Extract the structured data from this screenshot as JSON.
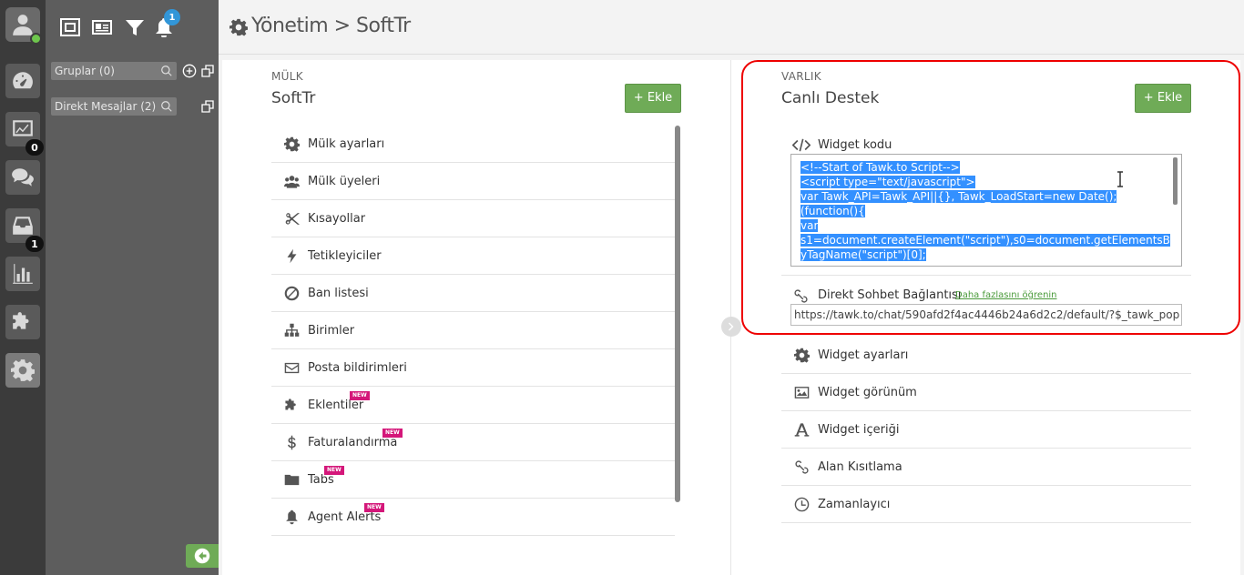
{
  "rail": {
    "badges": {
      "monitoring": "0",
      "inbox": "1"
    }
  },
  "panel2": {
    "notification_count": "1",
    "groups_search": "Gruplar (0)",
    "direct_messages_search": "Direkt Mesajlar (2)"
  },
  "header": {
    "title": "Yönetim > SoftTr"
  },
  "left": {
    "caption": "MÜLK",
    "title": "SoftTr",
    "add_label": "+ Ekle",
    "new_tag": "NEW",
    "items": [
      {
        "label": "Mülk ayarları",
        "icon": "gear-icon"
      },
      {
        "label": "Mülk üyeleri",
        "icon": "users-icon"
      },
      {
        "label": "Kısayollar",
        "icon": "scissors-icon"
      },
      {
        "label": "Tetikleyiciler",
        "icon": "bolt-icon"
      },
      {
        "label": "Ban listesi",
        "icon": "ban-icon"
      },
      {
        "label": "Birimler",
        "icon": "sitemap-icon"
      },
      {
        "label": "Posta bildirimleri",
        "icon": "envelope-icon"
      },
      {
        "label": "Eklentiler",
        "icon": "puzzle-icon",
        "new": true
      },
      {
        "label": "Faturalandırma",
        "icon": "dollar-icon",
        "new": true
      },
      {
        "label": "Tabs",
        "icon": "folder-icon",
        "new": true
      },
      {
        "label": "Agent Alerts",
        "icon": "bell-icon",
        "new": true
      }
    ]
  },
  "right": {
    "caption": "VARLIK",
    "title": "Canlı Destek",
    "add_label": "+ Ekle",
    "widget_code_label": "Widget kodu",
    "code_lines": [
      "<!--Start of Tawk.to Script-->",
      "<script type=\"text/javascript\">",
      "var Tawk_API=Tawk_API||{}, Tawk_LoadStart=new Date();",
      "(function(){",
      "var",
      "s1=document.createElement(\"script\"),s0=document.getElementsB",
      "yTagName(\"script\")[0];"
    ],
    "direct_link_label": "Direkt Sohbet Bağlantısı",
    "learn_more": "Daha fazlasını öğrenin",
    "direct_link_url": "https://tawk.to/chat/590afd2f4ac4446b24a6d2c2/default/?$_tawk_pop",
    "items": [
      {
        "label": "Widget ayarları",
        "icon": "gear-icon"
      },
      {
        "label": "Widget görünüm",
        "icon": "image-icon"
      },
      {
        "label": "Widget içeriği",
        "icon": "font-icon"
      },
      {
        "label": "Alan Kısıtlama",
        "icon": "link-icon"
      },
      {
        "label": "Zamanlayıcı",
        "icon": "clock-icon"
      }
    ]
  }
}
